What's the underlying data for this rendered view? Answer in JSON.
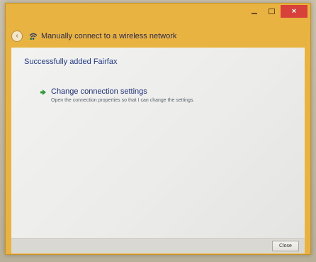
{
  "window": {
    "title": "Manually connect to a wireless network",
    "accent_color": "#e9b341",
    "close_color": "#d7413a",
    "controls": {
      "minimize_icon": "minimize-icon",
      "maximize_icon": "maximize-icon",
      "close_label": "×"
    }
  },
  "nav": {
    "back_icon": "back-arrow-icon",
    "back_glyph": "‹",
    "network_icon": "wireless-network-icon"
  },
  "main": {
    "status_text": "Successfully added Fairfax",
    "option": {
      "icon": "green-arrow-icon",
      "title": "Change connection settings",
      "description": "Open the connection properties so that I can change the settings."
    }
  },
  "footer": {
    "close_button_label": "Close"
  }
}
